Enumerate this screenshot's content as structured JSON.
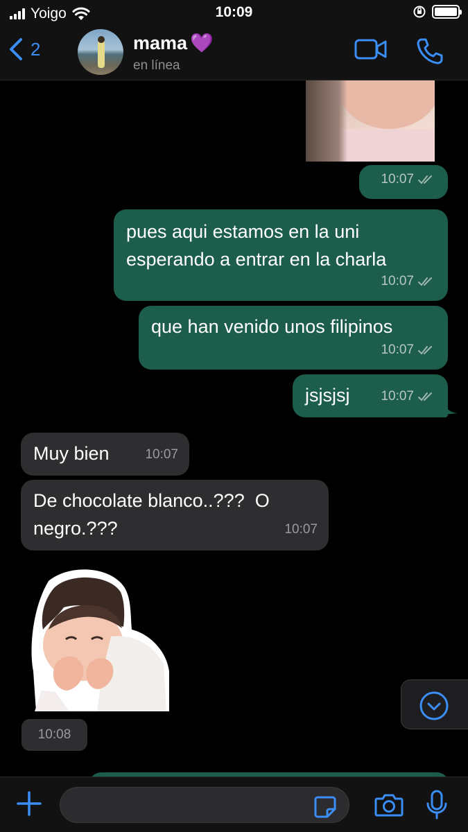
{
  "status_bar": {
    "carrier": "Yoigo",
    "time": "10:09"
  },
  "header": {
    "back_count": "2",
    "contact_name": "mama",
    "heart_emoji": "💜",
    "status": "en línea"
  },
  "messages": [
    {
      "direction": "outgoing",
      "type": "image",
      "time": "10:07",
      "status": "read"
    },
    {
      "direction": "outgoing",
      "type": "text",
      "lines": [
        "pues aqui estamos en la uni",
        "esperando a entrar en la charla"
      ],
      "time": "10:07",
      "status": "read"
    },
    {
      "direction": "outgoing",
      "type": "text",
      "lines": [
        "que han venido unos filipinos"
      ],
      "time": "10:07",
      "status": "read"
    },
    {
      "direction": "outgoing",
      "type": "text",
      "lines": [
        "jsjsjsj"
      ],
      "time": "10:07",
      "status": "read"
    },
    {
      "direction": "incoming",
      "type": "text",
      "lines": [
        "Muy bien"
      ],
      "time": "10:07"
    },
    {
      "direction": "incoming",
      "type": "text",
      "lines": [
        "De chocolate blanco..???  O",
        "negro.???"
      ],
      "time": "10:07"
    },
    {
      "direction": "incoming",
      "type": "sticker",
      "time": "10:08"
    }
  ],
  "colors": {
    "accent": "#3a8ef6",
    "outgoing_bubble": "#1d5d4b",
    "incoming_bubble": "#2e2e30",
    "background": "#000000"
  },
  "icons": [
    "back-chevron",
    "video-call",
    "phone",
    "plus",
    "sticker",
    "camera",
    "microphone",
    "scroll-down",
    "double-check"
  ]
}
